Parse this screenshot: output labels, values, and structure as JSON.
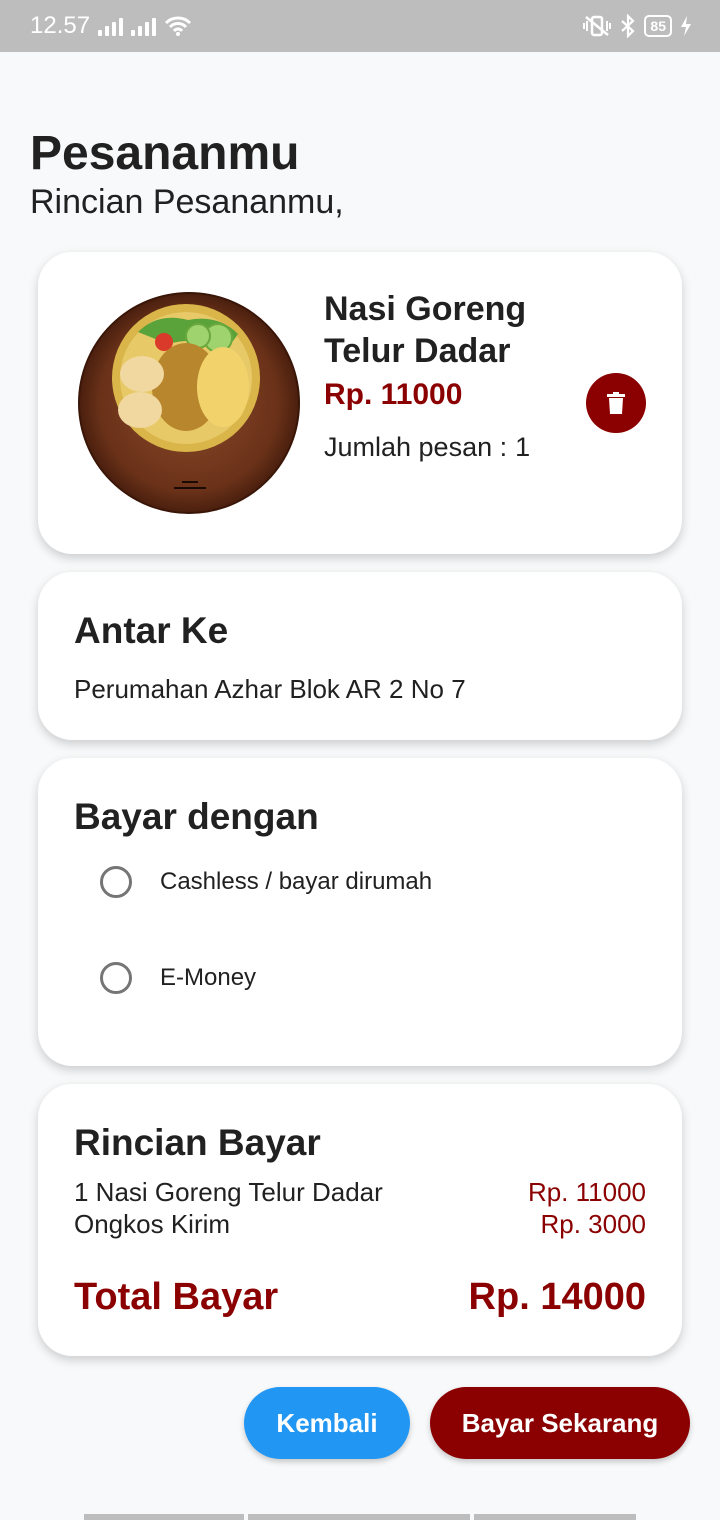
{
  "status_bar": {
    "time": "12.57",
    "battery": "85"
  },
  "header": {
    "title": "Pesananmu",
    "subtitle": "Rincian Pesananmu,"
  },
  "order_item": {
    "name": "Nasi Goreng Telur Dadar",
    "price": "Rp. 11000",
    "qty_label": "Jumlah pesan :",
    "qty_value": "1"
  },
  "address": {
    "title": "Antar Ke",
    "value": "Perumahan Azhar Blok AR 2 No 7"
  },
  "payment": {
    "title": "Bayar dengan",
    "options": [
      {
        "label": "Cashless / bayar dirumah",
        "selected": false
      },
      {
        "label": "E-Money",
        "selected": false
      }
    ]
  },
  "summary": {
    "title": "Rincian Bayar",
    "lines": [
      {
        "label": "1 Nasi Goreng Telur Dadar",
        "price": "Rp. 11000"
      },
      {
        "label": "Ongkos Kirim",
        "price": "Rp. 3000"
      }
    ],
    "total_label": "Total Bayar",
    "total_value": "Rp. 14000"
  },
  "buttons": {
    "back": "Kembali",
    "pay": "Bayar Sekarang"
  },
  "colors": {
    "accent_red": "#8b0000",
    "accent_blue": "#2196f3"
  }
}
